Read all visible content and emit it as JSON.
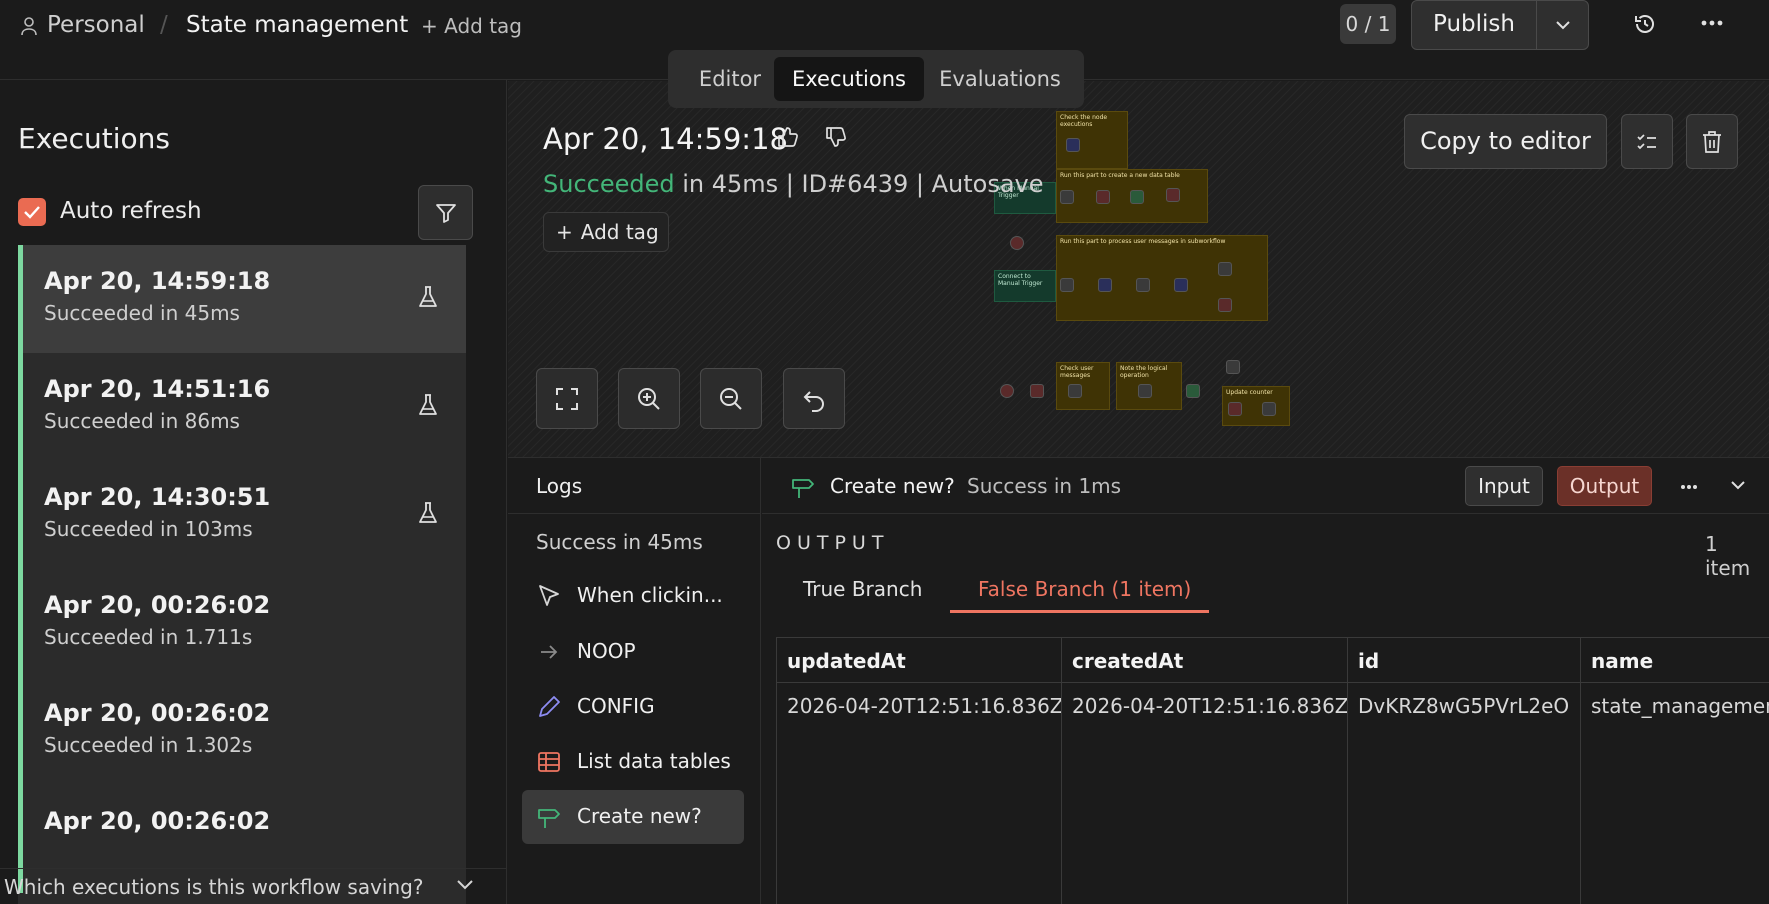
{
  "header": {
    "workspace": "Personal",
    "separator": "/",
    "workflow_name": "State management",
    "add_tag": "+ Add tag",
    "counter": "0 / 1",
    "publish": "Publish"
  },
  "view_tabs": [
    "Editor",
    "Executions",
    "Evaluations"
  ],
  "active_view_tab": "Executions",
  "sidebar": {
    "title": "Executions",
    "auto_refresh_label": "Auto refresh",
    "auto_refresh_checked": true,
    "executions": [
      {
        "time": "Apr 20, 14:59:18",
        "status": "Succeeded in 45ms",
        "selected": true
      },
      {
        "time": "Apr 20, 14:51:16",
        "status": "Succeeded in 86ms"
      },
      {
        "time": "Apr 20, 14:30:51",
        "status": "Succeeded in 103ms"
      },
      {
        "time": "Apr 20, 00:26:02",
        "status": "Succeeded in 1.711s"
      },
      {
        "time": "Apr 20, 00:26:02",
        "status": "Succeeded in 1.302s"
      },
      {
        "time": "Apr 20, 00:26:02",
        "status": ""
      }
    ],
    "saving_question": "Which executions is this workflow saving?"
  },
  "execution": {
    "date": "Apr 20, 14:59:18",
    "status": "Succeeded",
    "details": " in 45ms | ID#6439 | Autosave",
    "add_tag": "Add tag",
    "copy_to_editor": "Copy to editor"
  },
  "logs": {
    "title": "Logs",
    "summary": "Success in 45ms",
    "nodes": [
      {
        "label": "When clickin...",
        "icon": "cursor-icon"
      },
      {
        "label": "NOOP",
        "icon": "arrow-right-icon"
      },
      {
        "label": "CONFIG",
        "icon": "pencil-icon"
      },
      {
        "label": "List data tables",
        "icon": "table-icon"
      },
      {
        "label": "Create new?",
        "icon": "signpost-icon",
        "selected": true
      }
    ]
  },
  "output_panel": {
    "node_name": "Create new?",
    "node_status": "Success in 1ms",
    "input_btn": "Input",
    "output_btn": "Output",
    "section_label": "OUTPUT",
    "item_count": "1 item",
    "tabs": [
      "True Branch",
      "False Branch (1 item)"
    ],
    "active_tab": "False Branch (1 item)",
    "columns": [
      "updatedAt",
      "createdAt",
      "id",
      "name"
    ],
    "rows": [
      [
        "2026-04-20T12:51:16.836Z",
        "2026-04-20T12:51:16.836Z",
        "DvKRZ8wG5PVrL2eO",
        "state_managemen"
      ]
    ]
  },
  "colors": {
    "accent": "#ea6b52",
    "success": "#43b679",
    "row_stripe": "#7dd8a0",
    "output_active": "#6b3028"
  }
}
